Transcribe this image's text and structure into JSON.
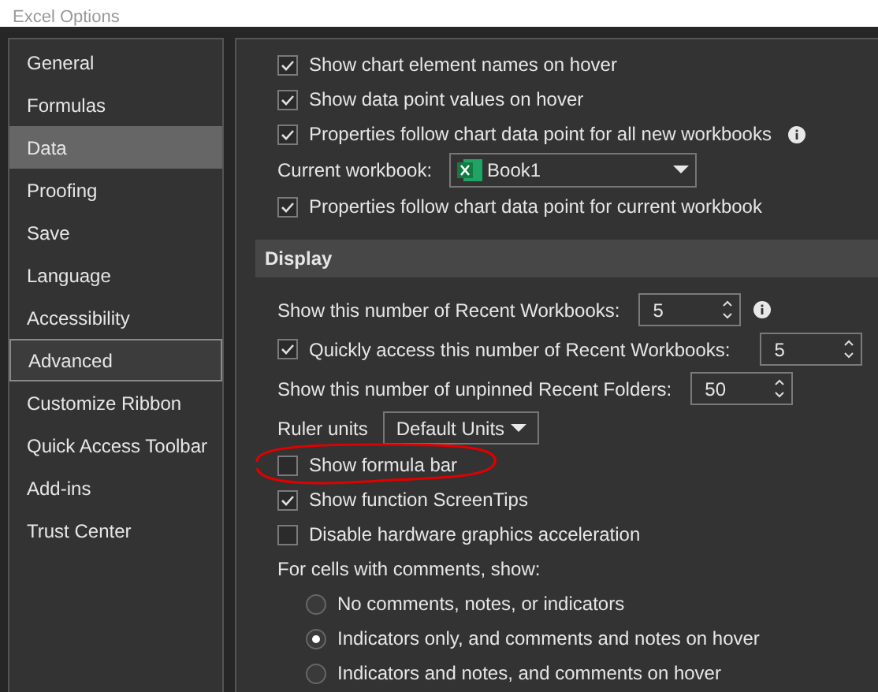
{
  "window": {
    "title": "Excel Options"
  },
  "sidebar": {
    "items": [
      {
        "label": "General",
        "selected": false,
        "focused": false
      },
      {
        "label": "Formulas",
        "selected": false,
        "focused": false
      },
      {
        "label": "Data",
        "selected": true,
        "focused": false
      },
      {
        "label": "Proofing",
        "selected": false,
        "focused": false
      },
      {
        "label": "Save",
        "selected": false,
        "focused": false
      },
      {
        "label": "Language",
        "selected": false,
        "focused": false
      },
      {
        "label": "Accessibility",
        "selected": false,
        "focused": false
      },
      {
        "label": "Advanced",
        "selected": false,
        "focused": true
      },
      {
        "label": "Customize Ribbon",
        "selected": false,
        "focused": false
      },
      {
        "label": "Quick Access Toolbar",
        "selected": false,
        "focused": false
      },
      {
        "label": "Add-ins",
        "selected": false,
        "focused": false
      },
      {
        "label": "Trust Center",
        "selected": false,
        "focused": false
      }
    ]
  },
  "options": [
    {
      "kind": "check",
      "label": "Show chart element names on hover",
      "checked": true
    },
    {
      "kind": "check",
      "label": "Show data point values on hover",
      "checked": true
    },
    {
      "kind": "check",
      "label": "Properties follow chart data point for all new workbooks",
      "checked": true,
      "info": true
    },
    {
      "kind": "workbook",
      "label": "Current workbook:",
      "value": "Book1"
    },
    {
      "kind": "check",
      "label": "Properties follow chart data point for current workbook",
      "checked": true
    },
    {
      "kind": "header",
      "label": "Display"
    },
    {
      "kind": "spin",
      "label": "Show this number of Recent Workbooks:",
      "value": "5",
      "info": true
    },
    {
      "kind": "checkspin",
      "label": "Quickly access this number of Recent Workbooks:",
      "checked": true,
      "value": "5"
    },
    {
      "kind": "spin",
      "label": "Show this number of unpinned Recent Folders:",
      "value": "50"
    },
    {
      "kind": "select",
      "label": "Ruler units",
      "value": "Default Units"
    },
    {
      "kind": "check",
      "label": "Show formula bar",
      "checked": false,
      "circled": true
    },
    {
      "kind": "check",
      "label": "Show function ScreenTips",
      "checked": true
    },
    {
      "kind": "check",
      "label": "Disable hardware graphics acceleration",
      "checked": false
    },
    {
      "kind": "label",
      "label": "For cells with comments, show:"
    },
    {
      "kind": "radio",
      "label": "No comments, notes, or indicators",
      "selected": false
    },
    {
      "kind": "radio",
      "label": "Indicators only, and comments and notes on hover",
      "selected": true
    },
    {
      "kind": "radio",
      "label": "Indicators and notes, and comments on hover",
      "selected": false
    }
  ]
}
